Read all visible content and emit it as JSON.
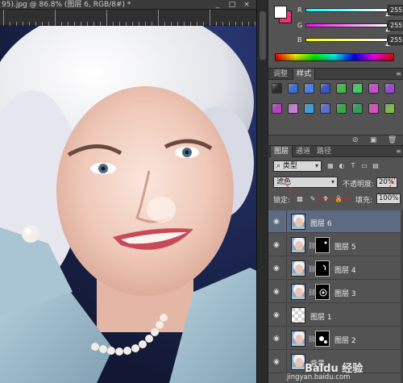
{
  "document": {
    "title": "95).jpg @ 86.8% (图层 6, RGB/8#) *",
    "window_buttons": [
      "_",
      "□",
      "×"
    ]
  },
  "color_panel": {
    "foreground": "#ffffff",
    "background": "#e8327a",
    "channels": [
      {
        "label": "R",
        "value": "255",
        "level": 1.0,
        "gradient": [
          "#00ffff",
          "#ffffff"
        ]
      },
      {
        "label": "G",
        "value": "255",
        "level": 1.0,
        "gradient": [
          "#ff00ff",
          "#ffffff"
        ]
      },
      {
        "label": "B",
        "value": "255",
        "level": 1.0,
        "gradient": [
          "#ffff00",
          "#ffffff"
        ]
      }
    ]
  },
  "styles_panel": {
    "tabs": [
      "调整",
      "样式"
    ],
    "active_tab": "样式",
    "chip_colors": [
      [
        "#2d2d2d",
        "#3c6fd6",
        "#4a7ee8",
        "#3b56c8",
        "#45b84a",
        "#44cc66",
        "#c94fd0",
        "#9b48d8"
      ],
      [
        "#b83fc1",
        "#c77fd8",
        "#3aa0d8",
        "#5a6ed0",
        "#3aa94a",
        "#2fa05a",
        "#d84fc0",
        "#7db84a"
      ]
    ],
    "footer_icons": [
      "no-style-icon",
      "new-style-icon",
      "trash-icon"
    ]
  },
  "layers_panel": {
    "tabs": [
      "图层",
      "通道",
      "路径"
    ],
    "active_tab": "图层",
    "filter_label": "类型",
    "blend_mode": "滤色",
    "opacity_label": "不透明度:",
    "opacity_value": "20%",
    "lock_label": "锁定:",
    "fill_label": "填充:",
    "fill_value": "100%",
    "layers": [
      {
        "name": "图层 6",
        "selected": true,
        "has_mask": false,
        "thumb": "face"
      },
      {
        "name": "图层 5",
        "selected": false,
        "has_mask": true,
        "thumb": "face"
      },
      {
        "name": "图层 4",
        "selected": false,
        "has_mask": true,
        "thumb": "face"
      },
      {
        "name": "图层 3",
        "selected": false,
        "has_mask": true,
        "thumb": "face"
      },
      {
        "name": "图层 1",
        "selected": false,
        "has_mask": false,
        "thumb": "transparent"
      },
      {
        "name": "图层 2",
        "selected": false,
        "has_mask": true,
        "thumb": "face"
      },
      {
        "name": "背景",
        "selected": false,
        "has_mask": false,
        "thumb": "face"
      }
    ]
  },
  "watermark": {
    "logo": "Baidu 经验",
    "url": "jingyan.baidu.com"
  }
}
